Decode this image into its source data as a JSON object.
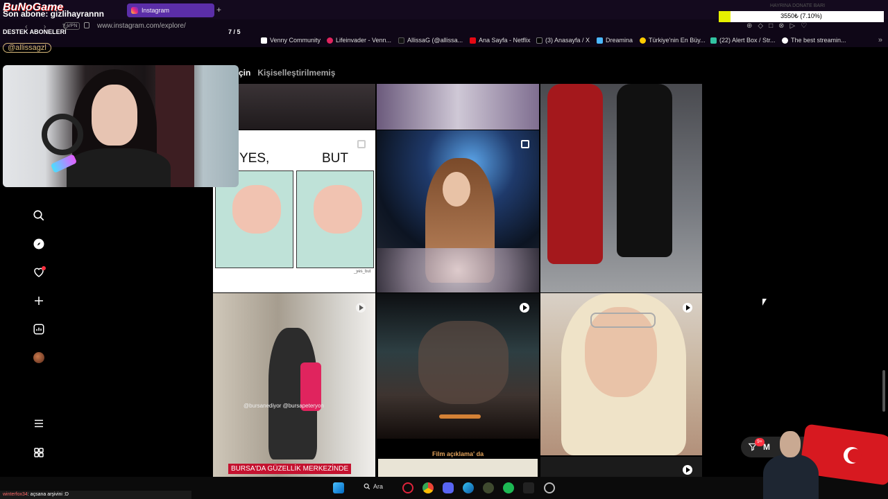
{
  "stream": {
    "channel_title": "BuNoGame",
    "sub_line": "Son abone: gizlihayrannn",
    "destek_label": "DESTEK ABONELERI",
    "counter": "7 / 5",
    "handle": "@allissagzl"
  },
  "browser": {
    "active_tab": "Instagram",
    "url": "www.instagram.com/explore/",
    "vpn_label": "VPN",
    "bookmarks": [
      "Venny Community",
      "Lifeinvader - Venn...",
      "AllissaG (@allissa...",
      "Ana Sayfa - Netflix",
      "(3) Anasayfa / X",
      "Dreamina",
      "Türkiye'nin En Büy...",
      "(22) Alert Box / Str...",
      "The best streamin..."
    ]
  },
  "instagram": {
    "tab_partial": "çin",
    "tab_other": "Kişiselleştirilmemiş",
    "sidebar_icons": [
      "search-icon",
      "explore-icon",
      "notifications-heart-icon",
      "create-plus-icon",
      "dashboard-icon",
      "profile-avatar",
      "menu-icon",
      "more-apps-icon"
    ],
    "posts": [
      {
        "type": "image",
        "caption_left": "YES,",
        "caption_right": "BUT",
        "watermark": "_yes_but"
      },
      {
        "type": "carousel"
      },
      {
        "type": "reel"
      },
      {
        "type": "reel",
        "overlay_text": "@bursanediyor @bursapeteryon",
        "caption": "BURSA'DA GÜZELLİK MERKEZİNDE"
      },
      {
        "type": "reel"
      },
      {
        "type": "reel"
      },
      {
        "type": "image",
        "caption": "Film açıklama' da"
      }
    ],
    "notification_initial": "M",
    "notification_count": "9+"
  },
  "donate": {
    "title": "HAYRINA DONATE BARI",
    "text": "3550₺ (7.10%)",
    "progress_fraction": 0.071,
    "fill_color": "#e6f000"
  },
  "chat": {
    "user": "winterfox34",
    "message": ": açsana arşivini :D"
  },
  "taskbar": {
    "search_label": "Ara"
  },
  "colors": {
    "tab_active": "#5b2ea8",
    "notification_red": "#ff3040",
    "flag_red": "#d71920"
  }
}
